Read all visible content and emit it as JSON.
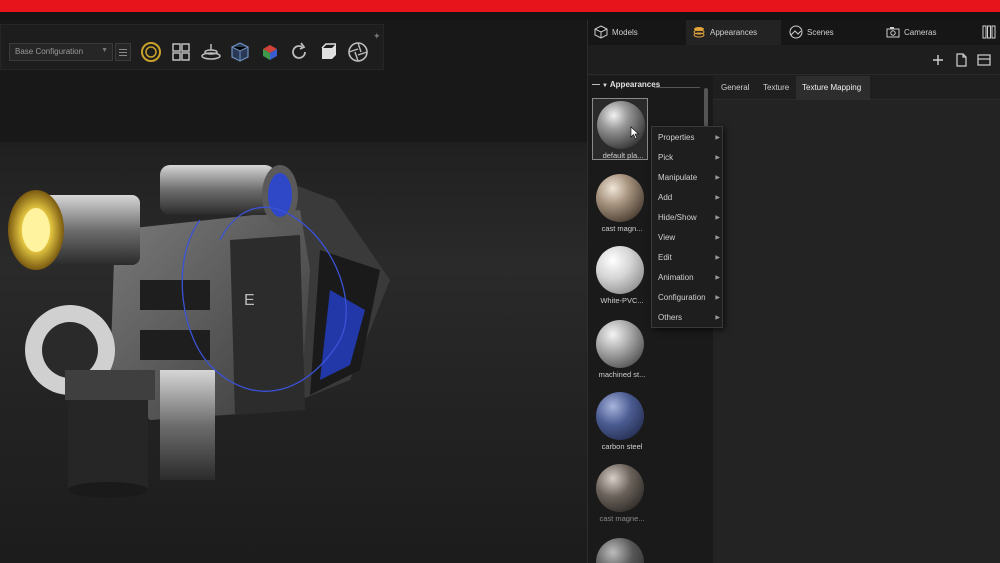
{
  "toolbar": {
    "configuration": "Base Configuration",
    "tools": [
      "environment-icon",
      "explode-icon",
      "turntable-icon",
      "section-cube-icon",
      "color-cube-icon",
      "refresh-icon",
      "box-icon",
      "aperture-icon"
    ]
  },
  "panel": {
    "tabs": [
      {
        "label": "Models",
        "icon": "cube-icon"
      },
      {
        "label": "Appearances",
        "icon": "appearance-stack-icon"
      },
      {
        "label": "Scenes",
        "icon": "scene-icon"
      },
      {
        "label": "Cameras",
        "icon": "camera-icon"
      }
    ],
    "actions": [
      "add-icon",
      "new-document-icon",
      "layout-icon"
    ]
  },
  "library": {
    "title": "Appearances",
    "items": [
      {
        "label": "default pla...",
        "color": "#6c6c6c"
      },
      {
        "label": "cast magn...",
        "color": "#8a7a68"
      },
      {
        "label": "White-PVC...",
        "color": "#b8b8b8"
      },
      {
        "label": "machined st...",
        "color": "#8c8c8c"
      },
      {
        "label": "carbon steel",
        "color": "#3b4a78"
      },
      {
        "label": "cast magne...",
        "color": "#4a4440"
      }
    ]
  },
  "props": {
    "tabs": [
      "General",
      "Texture",
      "Texture Mapping"
    ],
    "active_tab": "Texture Mapping"
  },
  "context_menu": {
    "items": [
      "Properties",
      "Pick",
      "Manipulate",
      "Add",
      "Hide/Show",
      "View",
      "Edit",
      "Animation",
      "Configuration",
      "Others"
    ]
  },
  "model": {
    "label": "E"
  }
}
